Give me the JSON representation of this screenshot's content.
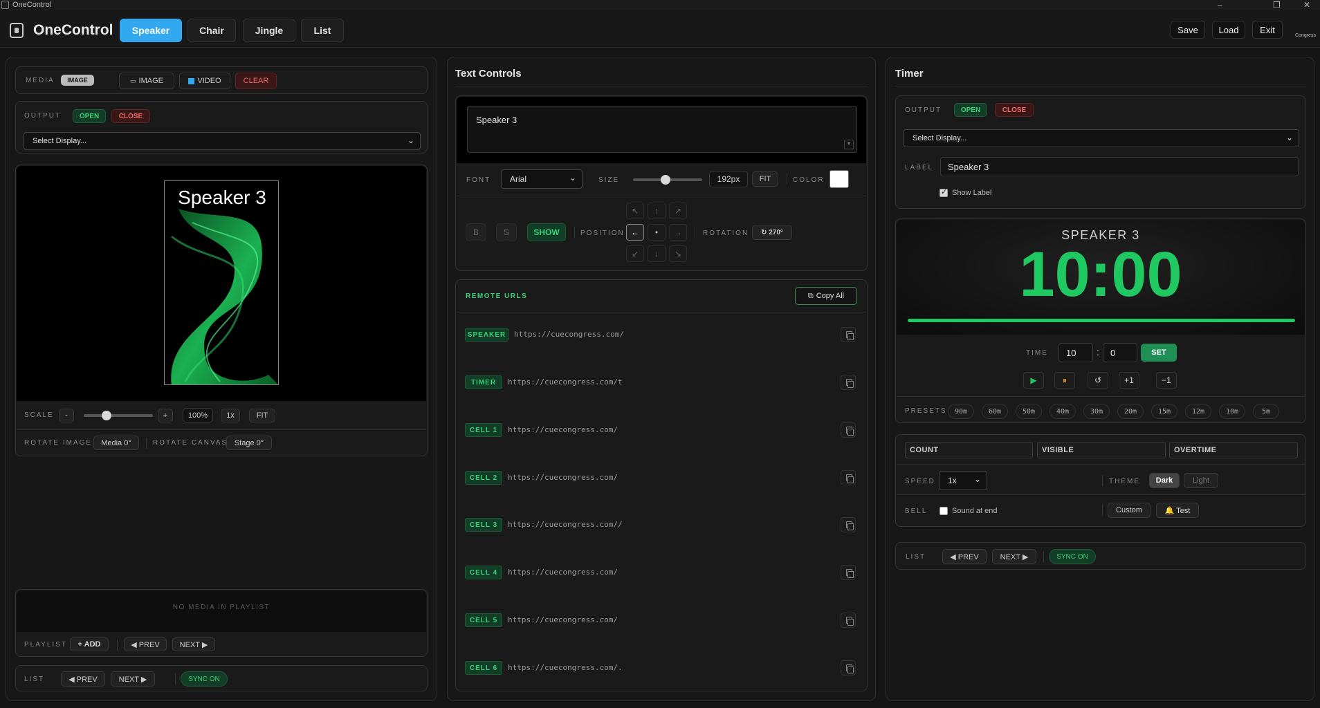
{
  "window": {
    "title": "OneControl",
    "controls": [
      "–",
      "❐",
      "✕"
    ]
  },
  "topbar": {
    "logo": "OneControl",
    "tabs": [
      "Speaker",
      "Chair",
      "Jingle",
      "List"
    ],
    "active_tab": "Speaker",
    "save": "Save",
    "load": "Load",
    "exit": "Exit",
    "brand": "Congress"
  },
  "left": {
    "media_label": "MEDIA",
    "media_badge": "IMAGE",
    "image_btn": "IMAGE",
    "video_btn": "VIDEO",
    "clear_btn": "CLEAR",
    "output_label": "OUTPUT",
    "open_btn": "OPEN",
    "close_btn": "CLOSE",
    "display_select": "Select Display...",
    "preview_text": "Speaker 3",
    "scale_label": "SCALE",
    "scale_minus": "-",
    "scale_plus": "+",
    "scale_value": "100%",
    "scale_1x": "1x",
    "scale_fit": "FIT",
    "rotate_image_label": "ROTATE IMAGE",
    "rotate_image_value": "Media 0°",
    "rotate_canvas_label": "ROTATE CANVAS",
    "rotate_canvas_value": "Stage 0°",
    "playlist_empty": "NO MEDIA IN PLAYLIST",
    "playlist_label": "PLAYLIST",
    "playlist_add": "+ ADD",
    "playlist_prev": "◀ PREV",
    "playlist_next": "NEXT ▶",
    "list_label": "LIST",
    "list_prev": "◀ PREV",
    "list_next": "NEXT ▶",
    "sync": "SYNC ON"
  },
  "middle": {
    "title": "Text Controls",
    "text_value": "Speaker 3",
    "font_label": "FONT",
    "font_value": "Arial",
    "size_label": "SIZE",
    "size_value": "192px",
    "fit": "FIT",
    "color_label": "COLOR",
    "color_value": "#ffffff",
    "bold": "B",
    "strike": "S",
    "show": "SHOW",
    "position_label": "POSITION",
    "position_arrows": [
      "↖",
      "↑",
      "↗",
      "←",
      "•",
      "→",
      "↙",
      "↓",
      "↘"
    ],
    "rotation_label": "ROTATION",
    "rotation_value": "↻ 270°",
    "remote_title": "REMOTE URLS",
    "copy_all": "Copy All",
    "urls": [
      {
        "tag": "SPEAKER",
        "url": "https://cuecongress.com/"
      },
      {
        "tag": "TIMER",
        "url": "https://cuecongress.com/t"
      },
      {
        "tag": "CELL 1",
        "url": "https://cuecongress.com/"
      },
      {
        "tag": "CELL 2",
        "url": "https://cuecongress.com/"
      },
      {
        "tag": "CELL 3",
        "url": "https://cuecongress.com//"
      },
      {
        "tag": "CELL 4",
        "url": "https://cuecongress.com/"
      },
      {
        "tag": "CELL 5",
        "url": "https://cuecongress.com/"
      },
      {
        "tag": "CELL 6",
        "url": "https://cuecongress.com/."
      }
    ]
  },
  "right": {
    "title": "Timer",
    "output_label": "OUTPUT",
    "open_btn": "OPEN",
    "close_btn": "CLOSE",
    "display_select": "Select Display...",
    "label_label": "LABEL",
    "label_value": "Speaker 3",
    "show_label": "Show Label",
    "display_name": "SPEAKER 3",
    "display_time": "10:00",
    "progress": 1.0,
    "time_label": "TIME",
    "time_min": "10",
    "time_sep": ":",
    "time_sec": "0",
    "set_btn": "SET",
    "play": "▶",
    "pause": "⏸",
    "reset": "↺",
    "plus1": "+1",
    "minus1": "−1",
    "presets_label": "PRESETS",
    "presets": [
      "90m",
      "60m",
      "50m",
      "40m",
      "30m",
      "20m",
      "15m",
      "12m",
      "10m",
      "5m"
    ],
    "count": "COUNT",
    "visible": "VISIBLE",
    "overtime": "OVERTIME",
    "speed_label": "SPEED",
    "speed_value": "1x",
    "theme_label": "THEME",
    "theme_dark": "Dark",
    "theme_light": "Light",
    "bell_label": "BELL",
    "sound_at_end": "Sound at end",
    "custom": "Custom",
    "test": "🔔 Test",
    "list_label": "LIST",
    "list_prev": "◀ PREV",
    "list_next": "NEXT ▶",
    "sync": "SYNC ON",
    "accent": "#1fc860"
  }
}
